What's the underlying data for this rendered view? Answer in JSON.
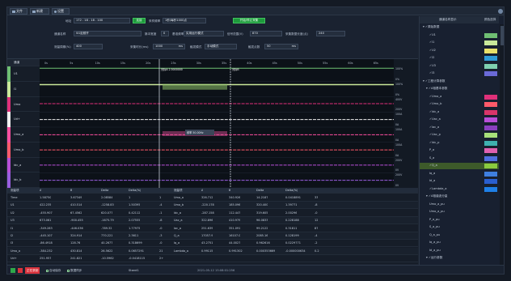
{
  "toolbar": {
    "buttons": [
      {
        "label": "文件",
        "icon": "folder-icon"
      },
      {
        "label": "新建",
        "icon": "new-window-icon"
      },
      {
        "label": "设置",
        "icon": "settings-icon"
      }
    ]
  },
  "settings": {
    "ip_label": "地址",
    "ip_value": "172 . 18 . 18 . 100",
    "connect_btn": "连接",
    "freq_label": "采样频率",
    "freq_value": "1秒/每秒1000点",
    "start_btn": "开始/停止采集",
    "channel_label": "通道名称",
    "channel_value": "SG定频开",
    "pulse_label": "脉冲宽度",
    "pulse_value": "0",
    "base_label": "基准频率",
    "base_value": "实用运行模式",
    "range_label": "信号范围(V)",
    "range_value": "870",
    "zoom_label": "采集数据长度(点)",
    "zoom_value": "240",
    "period_label": "测量周期(%)",
    "period_value": "400",
    "dur_label": "采集时长(ms)",
    "dur_value": "1000",
    "dur_unit": "ms",
    "mode_label": "触发模式",
    "mode_value": "手动模式",
    "trig_label": "触发点数",
    "trig_value": "50",
    "trig_unit": "ms"
  },
  "chart": {
    "corner_label": "通道",
    "time_ticks": [
      "0s",
      "5s",
      "10s",
      "15s",
      "20s",
      "25s",
      "30s",
      "35s",
      "40s",
      "45s",
      "50s",
      "55s",
      "60s",
      "65s"
    ],
    "channels": [
      {
        "name": "U1",
        "color": "#6fbf73",
        "level": 0.88,
        "axis_top": "100%",
        "axis_bottom": "0%"
      },
      {
        "name": "I1",
        "color": "#c9e89a",
        "level": 0.8,
        "axis_top": "100%",
        "axis_bottom": "0%"
      },
      {
        "name": "Umo",
        "color": "#e0307a",
        "level": 0.55,
        "axis_top": "400V",
        "axis_bottom": "200V"
      },
      {
        "name": "Ud+",
        "color": "#f0f0f0",
        "level": 0.5,
        "axis_top": "100A",
        "axis_bottom": "0A"
      },
      {
        "name": "Umo_a",
        "color": "#ff4fa0",
        "level": 0.5,
        "axis_top": "100A",
        "axis_bottom": "0A"
      },
      {
        "name": "Umo_b",
        "color": "#ff5a6a",
        "level": 0.5,
        "axis_top": "100A",
        "axis_bottom": "0A"
      },
      {
        "name": "Idc_a",
        "color": "#b84fd8",
        "level": 0.5,
        "axis_top": "200V",
        "axis_bottom": "0V"
      },
      {
        "name": "Idc_b",
        "color": "#9a5ee0",
        "level": 0.5,
        "axis_top": "200V",
        "axis_bottom": "0V"
      }
    ],
    "cursor_a_label": "光标A 2.5000000",
    "cursor_b_label": "光标B",
    "tooltip": "频率 50.00Hz"
  },
  "table": {
    "headers": [
      "测量项",
      "A",
      "B",
      "Delta",
      "Delta(%)",
      "",
      "测量项",
      "A",
      "B",
      "Delta",
      "Delta(%)",
      ""
    ],
    "rows": [
      [
        "Time",
        "1.58750",
        "3.67349",
        "2.08584",
        "1",
        "1",
        "Umo_a",
        "326.712",
        "340.926",
        "14.2187",
        "0.0418891",
        "33"
      ],
      [
        "U1",
        "422.235",
        "410.514",
        "-1258.83",
        "1.50395",
        "-4",
        "Umo_b",
        "-220.178",
        "185.096",
        "320.400",
        "1.39771",
        "-8"
      ],
      [
        "U2",
        "-455.907",
        "67.4562",
        "620.077",
        "0.42112",
        "-1",
        "Idc_a",
        "-287.158",
        "112.447",
        "319.605",
        "2.00296",
        "-0"
      ],
      [
        "U3",
        "673.061",
        "-900.455",
        "-1675.79",
        "2.07555",
        "-8",
        "Uac_a",
        "322.896",
        "410.979",
        "96.0833",
        "0.228188",
        "12"
      ],
      [
        "I1",
        "-349.283",
        "-446.036",
        "-789.32",
        "1.77975",
        "-0",
        "Iac_a",
        "251.639",
        "351.091",
        "99.2122",
        "0.31811",
        "87"
      ],
      [
        "I2",
        "-445.107",
        "324.914",
        "770.221",
        "2.3611",
        "-3",
        "Q_a",
        "17057.9",
        "16107.0",
        "2085.16",
        "0.128199",
        "-4"
      ],
      [
        "I3",
        "-86.4918",
        "128.76",
        "40.2677",
        "0.318699",
        "-0",
        "Iq_a",
        "43.2751",
        "44.0027",
        "0.962616",
        "0.0229771",
        "-2"
      ],
      [
        "Umo_a",
        "-384.232",
        "430.814",
        "26.5622",
        "0.0657291",
        "21",
        "Lambda_a",
        "0.99115",
        "0.991302",
        "0.000353669",
        "-0.000000634",
        "0.2"
      ],
      [
        "Ud+",
        "251.957",
        "241.821",
        "-10.5962",
        "-0.0418115",
        "2+",
        "",
        "",
        "",
        "",
        "",
        ""
      ]
    ]
  },
  "status": {
    "rec_label": "正在录制",
    "save_label": "自动保存",
    "sync_label": "数据同步",
    "state": "Stand1",
    "timestamp": "2021-05-12 15:08:01:256"
  },
  "panel": {
    "header_name": "通道名称显示",
    "header_color": "颜色选择",
    "items": [
      {
        "text": "▾ ✓原始数据",
        "indent": 1,
        "color": ""
      },
      {
        "text": "✓U1",
        "indent": 3,
        "color": "#6fbf73"
      },
      {
        "text": "✓I1",
        "indent": 3,
        "color": "#c9e89a"
      },
      {
        "text": "✓U2",
        "indent": 3,
        "color": "#e8e06a"
      },
      {
        "text": "✓I2",
        "indent": 3,
        "color": "#2e9bd8"
      },
      {
        "text": "✓U3",
        "indent": 3,
        "color": "#7fd0b0"
      },
      {
        "text": "✓I3",
        "indent": 3,
        "color": "#6a6ad8"
      },
      {
        "text": "▾ ✓工程计算参数",
        "indent": 1,
        "color": ""
      },
      {
        "text": "▾ ✓A相基本参数",
        "indent": 2,
        "color": ""
      },
      {
        "text": "✓Umo_a",
        "indent": 3,
        "color": "#e0307a"
      },
      {
        "text": "✓Umo_b",
        "indent": 3,
        "color": "#ff5a6a"
      },
      {
        "text": "✓Idc_a",
        "indent": 3,
        "color": "#d8356a"
      },
      {
        "text": "✓Uac_a",
        "indent": 3,
        "color": "#b84fd8"
      },
      {
        "text": "✓Iac_a",
        "indent": 3,
        "color": "#8a3fc0"
      },
      {
        "text": "✓Uac_p",
        "indent": 3,
        "color": "#a8e07a"
      },
      {
        "text": "✓Idc_p",
        "indent": 3,
        "color": "#3fb0b0"
      },
      {
        "text": "P_a",
        "indent": 3,
        "color": "#e060b0"
      },
      {
        "text": "S_a",
        "indent": 3,
        "color": "#4f6fe0"
      },
      {
        "text": "✓Q_a",
        "indent": 3,
        "color": "#8acb3f",
        "selected": true
      },
      {
        "text": "Iq_a",
        "indent": 3,
        "color": "#3f7fe0"
      },
      {
        "text": "Id_a",
        "indent": 3,
        "color": "#2a5fd0"
      },
      {
        "text": "✓Lambda_a",
        "indent": 3,
        "color": "#1f80e8"
      },
      {
        "text": "▾ ✓A相谐波分量",
        "indent": 2,
        "color": ""
      },
      {
        "text": "Umo_a_pu",
        "indent": 3,
        "color": ""
      },
      {
        "text": "Umo_a_pu",
        "indent": 3,
        "color": ""
      },
      {
        "text": "P_a_pu",
        "indent": 3,
        "color": ""
      },
      {
        "text": "S_a_pu",
        "indent": 3,
        "color": ""
      },
      {
        "text": "Q_a_pu",
        "indent": 3,
        "color": ""
      },
      {
        "text": "Iq_a_pu",
        "indent": 3,
        "color": ""
      },
      {
        "text": "Id_a_pu",
        "indent": 3,
        "color": ""
      },
      {
        "text": "▾ ✓运行参数",
        "indent": 2,
        "color": ""
      }
    ]
  },
  "colors": {
    "accent_green": "#1e9a3c",
    "record_red": "#d8323c",
    "highlight_row": "#3d5a2a"
  }
}
